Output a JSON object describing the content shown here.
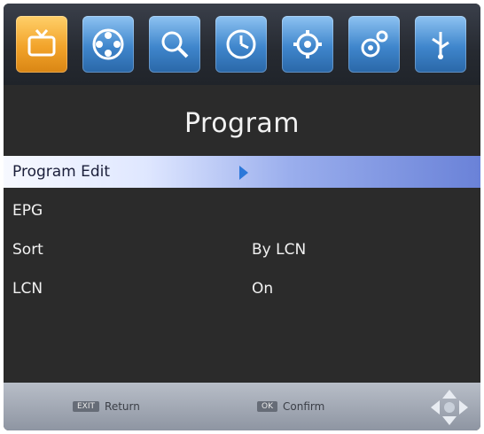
{
  "screen": {
    "title": "Program"
  },
  "tabs": [
    {
      "icon": "tv-icon",
      "active": true
    },
    {
      "icon": "film-reel-icon",
      "active": false
    },
    {
      "icon": "search-icon",
      "active": false
    },
    {
      "icon": "clock-icon",
      "active": false
    },
    {
      "icon": "settings-gear-icon",
      "active": false
    },
    {
      "icon": "gears-icon",
      "active": false
    },
    {
      "icon": "usb-icon",
      "active": false
    }
  ],
  "menu": {
    "items": [
      {
        "label": "Program Edit",
        "value": ""
      },
      {
        "label": "EPG",
        "value": ""
      },
      {
        "label": "Sort",
        "value": "By LCN"
      },
      {
        "label": "LCN",
        "value": "On"
      }
    ]
  },
  "footer": {
    "return_key": "EXIT",
    "return_label": "Return",
    "confirm_key": "OK",
    "confirm_label": "Confirm"
  },
  "colors": {
    "active_tab": "#f2a32a",
    "inactive_tab": "#3f86cc",
    "selection": "#9aaeed",
    "background": "#2b2b2b"
  }
}
